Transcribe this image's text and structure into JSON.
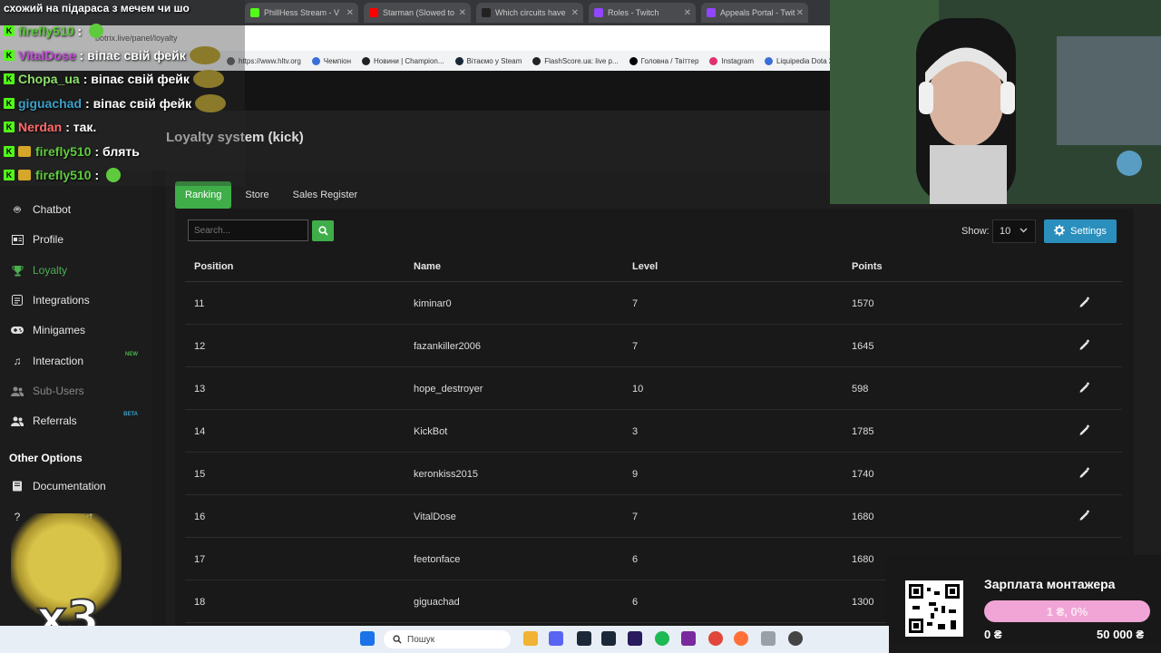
{
  "browser": {
    "tabs": [
      {
        "label": "PhillHess Stream - V",
        "color": "#53fc18"
      },
      {
        "label": "Starman (Slowed to ",
        "color": "#ff0000"
      },
      {
        "label": "Which circuits have ",
        "color": "#222222"
      },
      {
        "label": "Roles - Twitch",
        "color": "#9146ff"
      },
      {
        "label": "Appeals Portal - Twit",
        "color": "#9146ff"
      }
    ],
    "address": "botrix.live/panel/loyalty",
    "bookmarks": [
      {
        "label": "https://www.hltv.org",
        "color": "#666666"
      },
      {
        "label": "Чемпіон",
        "color": "#3b6fd8"
      },
      {
        "label": "Новини | Champion...",
        "color": "#222222"
      },
      {
        "label": "Вітаємо у Steam",
        "color": "#1b2838"
      },
      {
        "label": "FlashScore.ua: live p...",
        "color": "#222222"
      },
      {
        "label": "Головна / Твіттер",
        "color": "#000000"
      },
      {
        "label": "Instagram",
        "color": "#e1306c"
      },
      {
        "label": "Liquipedia Dota 2...",
        "color": "#3b6fd8"
      }
    ]
  },
  "page": {
    "title": "Loyalty system (kick)"
  },
  "sidebar": {
    "items": [
      {
        "label": "Chatbot",
        "icon": "robot-icon"
      },
      {
        "label": "Profile",
        "icon": "id-card-icon"
      },
      {
        "label": "Loyalty",
        "icon": "trophy-icon"
      },
      {
        "label": "Integrations",
        "icon": "plug-icon"
      },
      {
        "label": "Minigames",
        "icon": "gamepad-icon"
      },
      {
        "label": "Interaction",
        "icon": "music-icon",
        "badge": "NEW"
      },
      {
        "label": "Sub-Users",
        "icon": "users-icon"
      },
      {
        "label": "Referrals",
        "icon": "users-icon",
        "badge": "BETA"
      }
    ],
    "other_options_title": "Other Options",
    "other_items": [
      {
        "label": "Documentation",
        "icon": "book-icon"
      },
      {
        "label": "ort",
        "icon": "question-icon"
      }
    ]
  },
  "tabs": [
    {
      "label": "Ranking",
      "active": true
    },
    {
      "label": "Store",
      "active": false
    },
    {
      "label": "Sales Register",
      "active": false
    }
  ],
  "toolbar": {
    "search_placeholder": "Search...",
    "show_label": "Show:",
    "show_value": "10",
    "settings_label": "Settings"
  },
  "table": {
    "headers": [
      "Position",
      "Name",
      "Level",
      "Points"
    ],
    "rows": [
      {
        "position": "11",
        "name": "kiminar0",
        "level": "7",
        "points": "1570"
      },
      {
        "position": "12",
        "name": "fazankiller2006",
        "level": "7",
        "points": "1645"
      },
      {
        "position": "13",
        "name": "hope_destroyer",
        "level": "10",
        "points": "598"
      },
      {
        "position": "14",
        "name": "KickBot",
        "level": "3",
        "points": "1785"
      },
      {
        "position": "15",
        "name": "keronkiss2015",
        "level": "9",
        "points": "1740"
      },
      {
        "position": "16",
        "name": "VitalDose",
        "level": "7",
        "points": "1680"
      },
      {
        "position": "17",
        "name": "feetonface",
        "level": "6",
        "points": "1680"
      },
      {
        "position": "18",
        "name": "giguachad",
        "level": "6",
        "points": "1300"
      }
    ]
  },
  "chat": {
    "top_line": "схожий на підараса з мечем чи шо",
    "messages": [
      {
        "user": "firefly510",
        "user_color": "#5ecb3e",
        "text": " :",
        "badge": "kick",
        "emote": "smile"
      },
      {
        "user": "VitalDose",
        "user_color": "#c24fd6",
        "text": ": віпає свій фейк",
        "badge": "kick",
        "emote": "frog"
      },
      {
        "user": "Chopa_ua",
        "user_color": "#8ee06b",
        "text": ": віпає свій фейк",
        "badge": "kick",
        "emote": "frog"
      },
      {
        "user": "giguachad",
        "user_color": "#3aa0c8",
        "text": ": віпає свій фейк",
        "badge": "kick",
        "emote": "frog"
      },
      {
        "user": "Nerdan",
        "user_color": "#ff6b6b",
        "text": ": так.",
        "badge": "kick",
        "emote": ""
      },
      {
        "user": "firefly510",
        "user_color": "#5ecb3e",
        "text": ": блять",
        "badge": "kick-gift",
        "emote": ""
      },
      {
        "user": "firefly510",
        "user_color": "#5ecb3e",
        "text": " :",
        "badge": "kick-gift",
        "emote": "smile"
      }
    ]
  },
  "donation": {
    "title": "Зарплата монтажера",
    "progress_text": "1 ₴, 0%",
    "progress_fraction": 0.0,
    "min_label": "0 ₴",
    "max_label": "50 000 ₴"
  },
  "overlay": {
    "multiplier": "x3"
  },
  "taskbar": {
    "search_label": "Пошук"
  },
  "colors": {
    "accent_green": "#3fae49",
    "settings_blue": "#2a8fbd",
    "donation_pink": "#f0a5d6"
  }
}
